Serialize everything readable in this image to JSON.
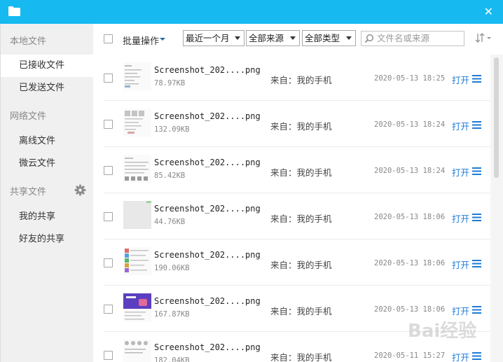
{
  "sidebar": {
    "group_local": "本地文件",
    "items_local": [
      "已接收文件",
      "已发送文件"
    ],
    "group_network": "网络文件",
    "items_network": [
      "离线文件",
      "微云文件"
    ],
    "group_shared": "共享文件",
    "items_shared": [
      "我的共享",
      "好友的共享"
    ]
  },
  "toolbar": {
    "batch_label": "批量操作",
    "time_filter": "最近一个月",
    "source_filter": "全部来源",
    "type_filter": "全部类型",
    "search_placeholder": "文件名或来源"
  },
  "files": [
    {
      "name": "Screenshot_202....png",
      "size": "78.97KB",
      "source": "来自：我的手机",
      "time": "2020-05-13 18:25",
      "action": "打开"
    },
    {
      "name": "Screenshot_202....png",
      "size": "132.09KB",
      "source": "来自：我的手机",
      "time": "2020-05-13 18:24",
      "action": "打开"
    },
    {
      "name": "Screenshot_202....png",
      "size": "85.42KB",
      "source": "来自：我的手机",
      "time": "2020-05-13 18:24",
      "action": "打开"
    },
    {
      "name": "Screenshot_202....png",
      "size": "44.76KB",
      "source": "来自：我的手机",
      "time": "2020-05-13 18:06",
      "action": "打开"
    },
    {
      "name": "Screenshot_202....png",
      "size": "190.06KB",
      "source": "来自：我的手机",
      "time": "2020-05-13 18:06",
      "action": "打开"
    },
    {
      "name": "Screenshot_202....png",
      "size": "167.87KB",
      "source": "来自：我的手机",
      "time": "2020-05-13 18:06",
      "action": "打开"
    },
    {
      "name": "Screenshot_202....png",
      "size": "182.04KB",
      "source": "来自：我的手机",
      "time": "2020-05-11 15:27",
      "action": "打开"
    }
  ],
  "watermark": "Bai经验",
  "colors": {
    "titlebar": "#16b9f0",
    "link": "#1e7bd6",
    "sidebar_bg": "#f0f0f0"
  }
}
